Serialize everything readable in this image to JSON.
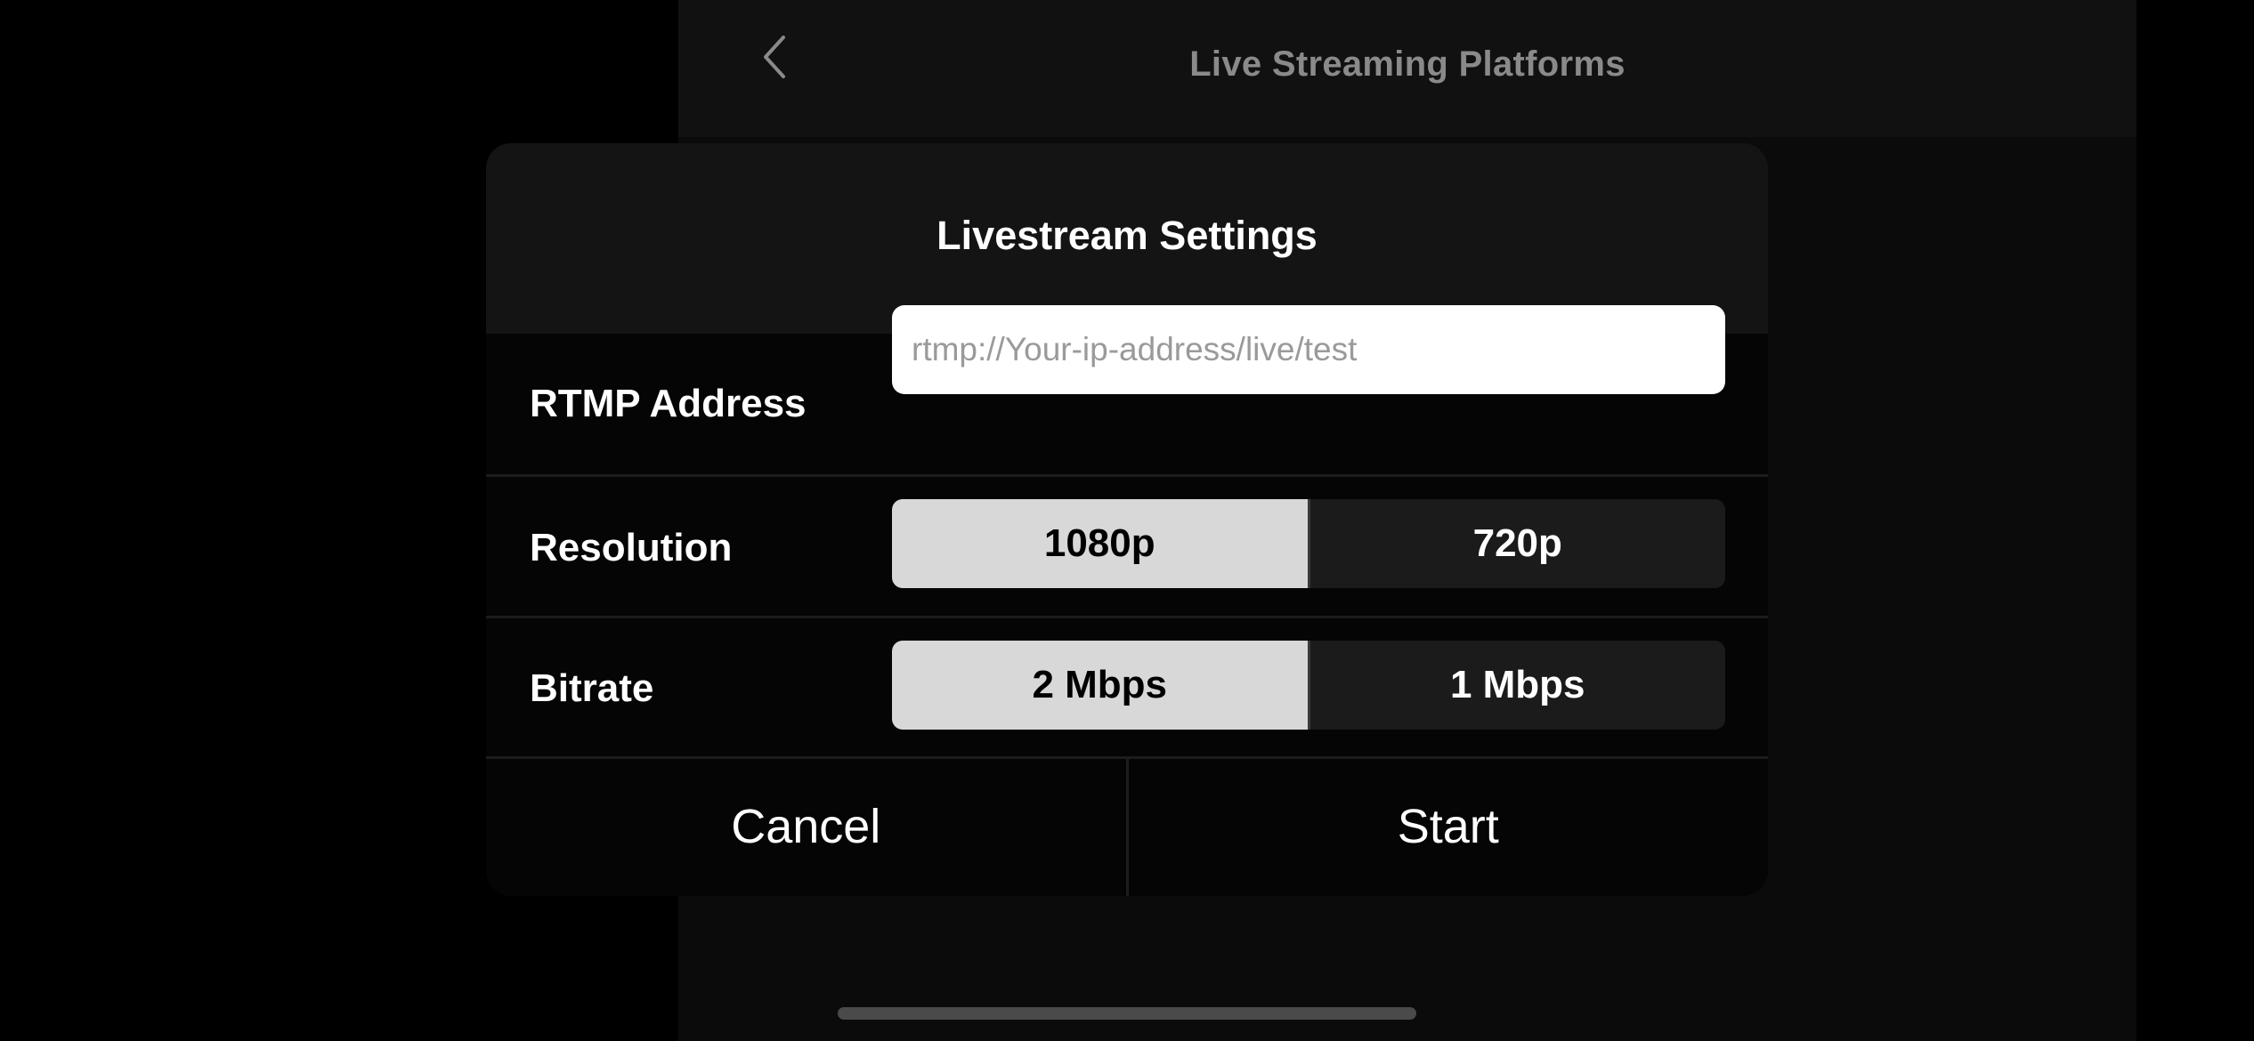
{
  "background_screen": {
    "title": "Live Streaming Platforms",
    "back_icon": "chevron-left-icon"
  },
  "dialog": {
    "title": "Livestream Settings",
    "rtmp": {
      "label": "RTMP Address",
      "value": "",
      "placeholder": "rtmp://Your-ip-address/live/test"
    },
    "resolution": {
      "label": "Resolution",
      "options": [
        "1080p",
        "720p"
      ],
      "selected": "1080p"
    },
    "bitrate": {
      "label": "Bitrate",
      "options": [
        "2 Mbps",
        "1 Mbps"
      ],
      "selected": "2 Mbps"
    },
    "cancel_label": "Cancel",
    "start_label": "Start"
  },
  "colors": {
    "selected_segment": "#d8d8d8",
    "unselected_segment": "#1b1b1b",
    "modal_background": "#050505",
    "modal_header": "#141414"
  }
}
